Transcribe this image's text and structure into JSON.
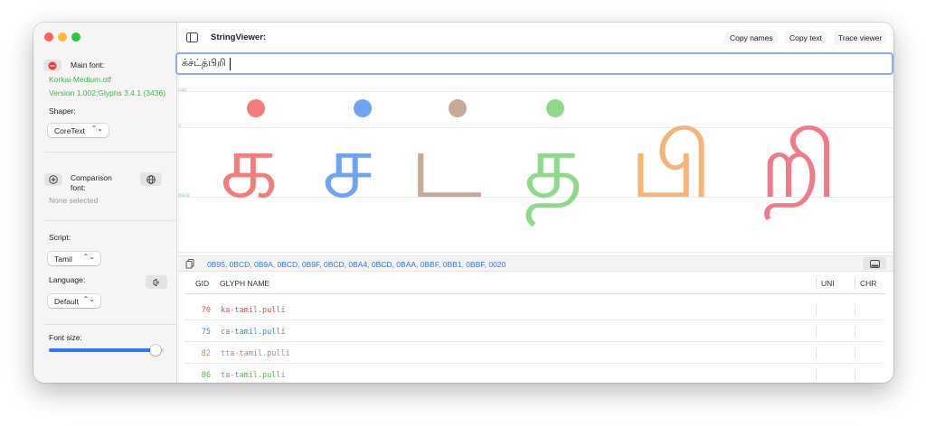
{
  "sidebar": {
    "main_font_label": "Main font:",
    "main_font_file": "Korkai-Medium.otf",
    "main_font_version": "Version 1.002;Glyphs 3.4.1 (3436)",
    "shaper_label": "Shaper:",
    "shaper_value": "CoreText",
    "comparison_label_line1": "Comparison",
    "comparison_label_line2": "font:",
    "comparison_value": "None selected",
    "script_label": "Script:",
    "script_value": "Tamil",
    "language_label": "Language:",
    "language_value": "Default",
    "font_size_label": "Font size:",
    "font_size_fraction": 0.93
  },
  "toolbar": {
    "title": "StringViewer:",
    "copy_names": "Copy names",
    "copy_text": "Copy text",
    "trace_viewer": "Trace viewer"
  },
  "input": {
    "value": "க்ச்ட்த்பிறி"
  },
  "preview": {
    "metric_labels": {
      "cap": "cap",
      "x": "x",
      "base": "base"
    },
    "glyphs": [
      {
        "char": "க",
        "color": "#f27d7a",
        "dot": true
      },
      {
        "char": "ச",
        "color": "#6fa4f2",
        "dot": true
      },
      {
        "char": "ட",
        "color": "#c6a996",
        "dot": true
      },
      {
        "char": "த",
        "color": "#8fd98a",
        "dot": true
      },
      {
        "char": "பி",
        "color": "#f5b478",
        "dot": false
      },
      {
        "char": "றி",
        "color": "#f07a8a",
        "dot": false
      }
    ]
  },
  "unicodes": "0B95, 0BCD, 0B9A, 0BCD, 0B9F, 0BCD, 0BA4, 0BCD, 0BAA, 0BBF, 0BB1, 0BBF, 0020",
  "table": {
    "headers": {
      "gid": "GID",
      "name": "GLYPH NAME",
      "uni": "UNI",
      "chr": "CHR"
    },
    "rows": [
      {
        "gid": "70",
        "name": "ka-tamil.pulli",
        "color": "#e2524a"
      },
      {
        "gid": "75",
        "name": "ca-tamil.pulli",
        "color": "#3d88e0"
      },
      {
        "gid": "82",
        "name": "tta-tamil.pulli",
        "color": "#b58a6e"
      },
      {
        "gid": "86",
        "name": "ta-tamil.pulli",
        "color": "#52b848"
      }
    ]
  }
}
